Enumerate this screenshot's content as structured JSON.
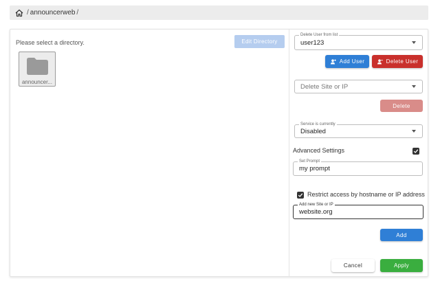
{
  "breadcrumb": {
    "home_icon": "home-icon",
    "path": "announcerweb",
    "separator": "/"
  },
  "left": {
    "hint": "Please select a directory.",
    "edit_directory_label": "Edit Directory",
    "folders": [
      {
        "name": "announcer...",
        "icon": "folder-icon"
      }
    ]
  },
  "right": {
    "delete_user": {
      "legend": "Delete User from list",
      "value": "user123"
    },
    "add_user_label": "Add User",
    "delete_user_label": "Delete User",
    "delete_site": {
      "placeholder": "Delete Site or IP"
    },
    "delete_label": "Delete",
    "service": {
      "legend": "Service is currently",
      "value": "Disabled"
    },
    "advanced_settings_label": "Advanced Settings",
    "advanced_settings_checked": true,
    "prompt": {
      "legend": "Set Prompt",
      "value": "my prompt"
    },
    "restrict_label": "Restrict access by hostname or IP address",
    "restrict_checked": true,
    "new_site": {
      "legend": "Add new Site or IP",
      "value": "website.org"
    },
    "add_label": "Add",
    "cancel_label": "Cancel",
    "apply_label": "Apply"
  },
  "colors": {
    "primary_blue": "#2f7fd6",
    "danger_red": "#c9302c",
    "danger_red_disabled": "#d98c89",
    "disabled_blue": "#b5cdef",
    "success_green": "#3aae3f"
  }
}
